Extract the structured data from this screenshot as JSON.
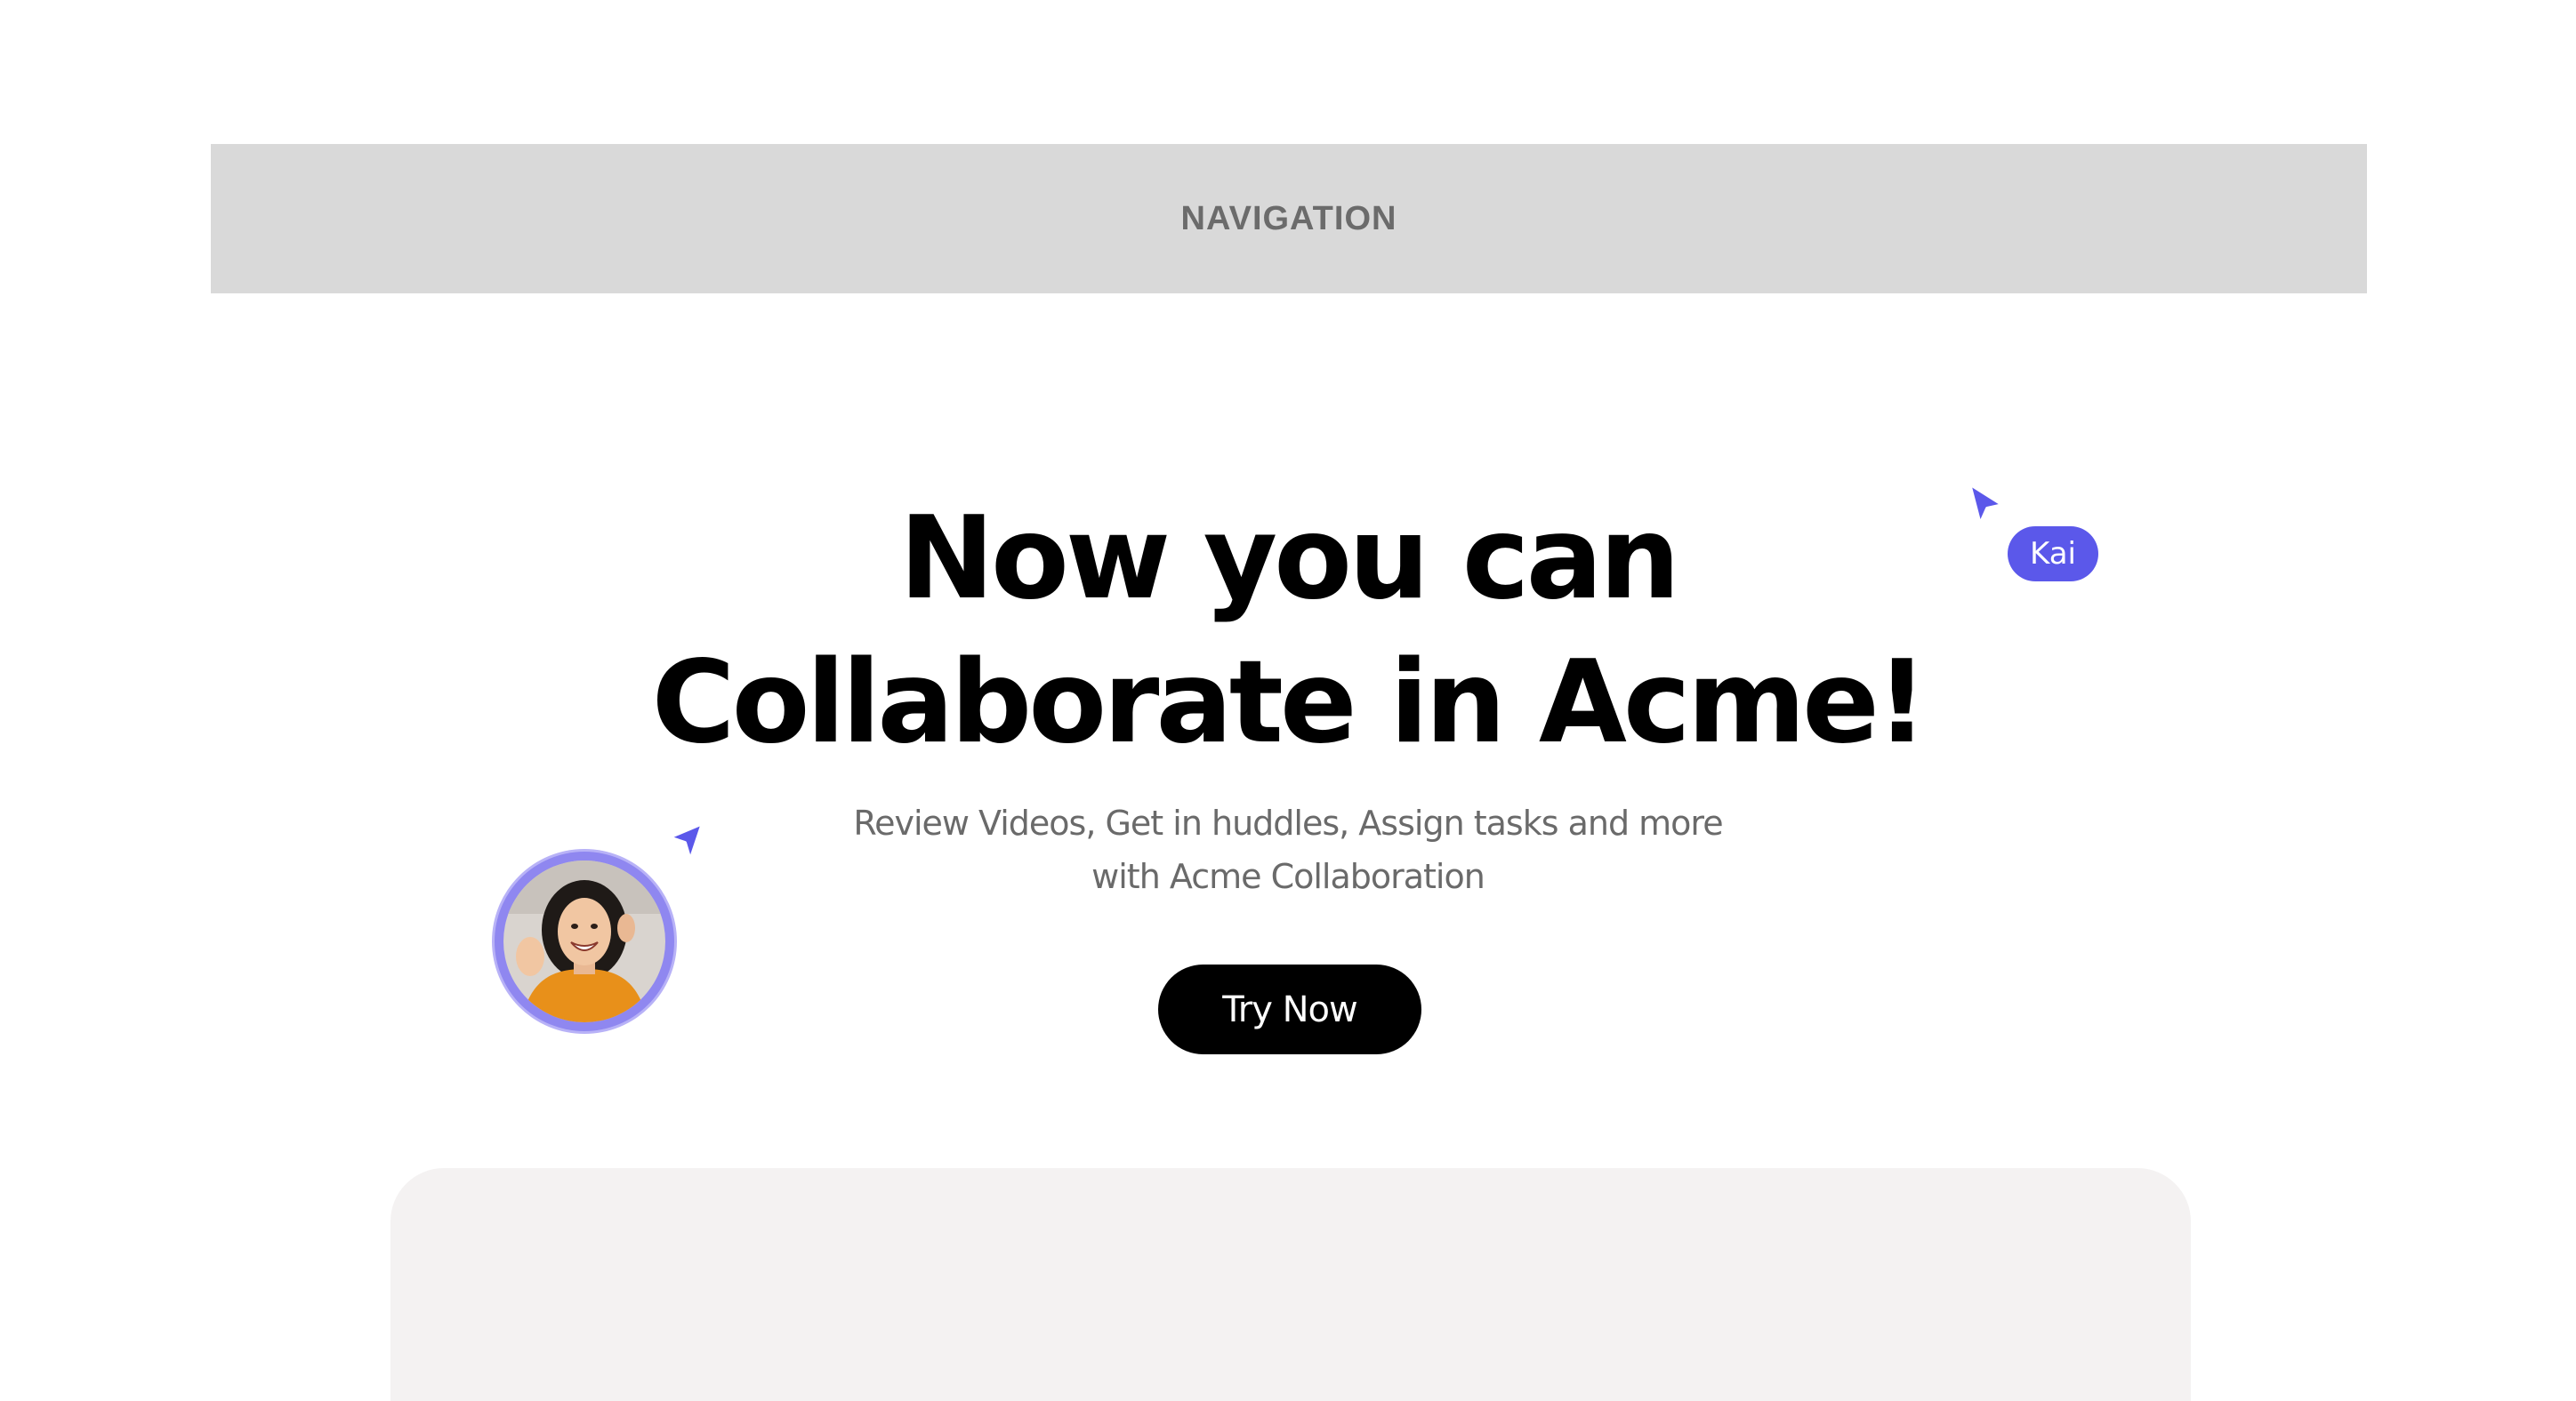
{
  "navigation": {
    "label": "NAVIGATION"
  },
  "hero": {
    "title_line1": "Now you can",
    "title_line2": "Collaborate in Acme!",
    "subtitle_line1": "Review Videos, Get in huddles, Assign tasks and more",
    "subtitle_line2": "with Acme Collaboration",
    "cta_label": "Try Now"
  },
  "collaborators": {
    "kai_name": "Kai",
    "cursor_color": "#5b58ea",
    "avatar_ring_color": "#8f87f0",
    "cursor_icon": "pointer-cursor-icon"
  },
  "colors": {
    "nav_background": "#d9d9d9",
    "cta_background": "#000000",
    "preview_background": "#f4f2f2"
  }
}
